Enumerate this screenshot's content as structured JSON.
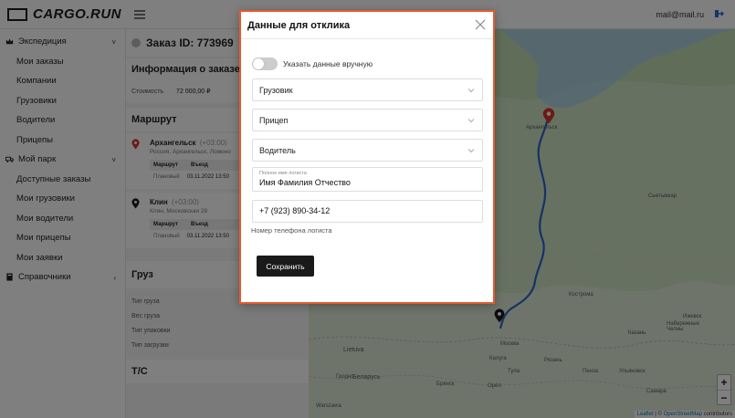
{
  "header": {
    "logo_text": "CARGO.RUN",
    "user_email": "mail@mail.ru"
  },
  "sidebar": {
    "items": [
      {
        "label": "Экспедиция",
        "type": "group",
        "chevron": "˅"
      },
      {
        "label": "Мои заказы",
        "type": "child"
      },
      {
        "label": "Компании",
        "type": "child"
      },
      {
        "label": "Грузовики",
        "type": "child"
      },
      {
        "label": "Водители",
        "type": "child"
      },
      {
        "label": "Прицепы",
        "type": "child"
      },
      {
        "label": "Мой парк",
        "type": "group",
        "chevron": "˅"
      },
      {
        "label": "Доступные заказы",
        "type": "child"
      },
      {
        "label": "Мои грузовики",
        "type": "child"
      },
      {
        "label": "Мои водители",
        "type": "child"
      },
      {
        "label": "Мои прицепы",
        "type": "child"
      },
      {
        "label": "Мои заявки",
        "type": "child"
      },
      {
        "label": "Справочники",
        "type": "group",
        "chevron": "‹"
      }
    ]
  },
  "order": {
    "title": "Заказ ID: 773969",
    "info_title": "Информация о заказе",
    "cost_label": "Стоимость",
    "cost_value": "72 000,00 ₽",
    "route_title": "Маршрут",
    "stops": [
      {
        "city": "Архангельск",
        "tz": "(+03:00)",
        "address": "Россия, Архангельск, Ломоно",
        "col1": "Маршрут",
        "col2": "Въезд",
        "kind": "Плановый",
        "date": "03.11.2022 13:50"
      },
      {
        "city": "Клин",
        "tz": "(+03:00)",
        "address": "Клин, Московская 28",
        "col1": "Маршрут",
        "col2": "Въезд",
        "kind": "Плановый",
        "date": "03.11.2022 13:50"
      }
    ],
    "cargo_title": "Груз",
    "cargo_fields": [
      "Тип груза",
      "Вес груза",
      "Тип упаковки",
      "Тип загрузки"
    ],
    "vehicle_title": "Т/С"
  },
  "map": {
    "labels": [
      {
        "text": "Архангельск"
      },
      {
        "text": "Сыктывкар"
      },
      {
        "text": "Кострома"
      },
      {
        "text": "Ижевск"
      },
      {
        "text": "Казань"
      },
      {
        "text": "Набережные Челны"
      },
      {
        "text": "Москва"
      },
      {
        "text": "Калуга"
      },
      {
        "text": "Рязань"
      },
      {
        "text": "Тула"
      },
      {
        "text": "Ульяновск"
      },
      {
        "text": "Самара"
      },
      {
        "text": "Орёл"
      },
      {
        "text": "Брянск"
      },
      {
        "text": "Гродно"
      },
      {
        "text": "Беларусь"
      },
      {
        "text": "Lietuva"
      },
      {
        "text": "Warszawa"
      },
      {
        "text": "Пенза"
      }
    ],
    "zoom_in": "+",
    "zoom_out": "−",
    "attribution_leaflet": "Leaflet",
    "attribution_sep": " | © ",
    "attribution_osm": "OpenStreetMap",
    "attribution_tail": " contributors",
    "colors": {
      "route": "#2f63c9",
      "pin_start": "#d8342a",
      "pin_end": "#1b1b1b"
    }
  },
  "modal": {
    "title": "Данные для отклика",
    "toggle_label": "Указать данные вручную",
    "truck_placeholder": "Грузовик",
    "trailer_placeholder": "Прицеп",
    "driver_placeholder": "Водитель",
    "logist_name_label": "Полное имя логиста",
    "logist_name_value": "Имя  Фамилия Отчество",
    "phone_value": "+7 (923) 890-34-12",
    "phone_helper": "Номер телефона логиста",
    "save_label": "Сохранить",
    "border_color": "#e8592a"
  }
}
